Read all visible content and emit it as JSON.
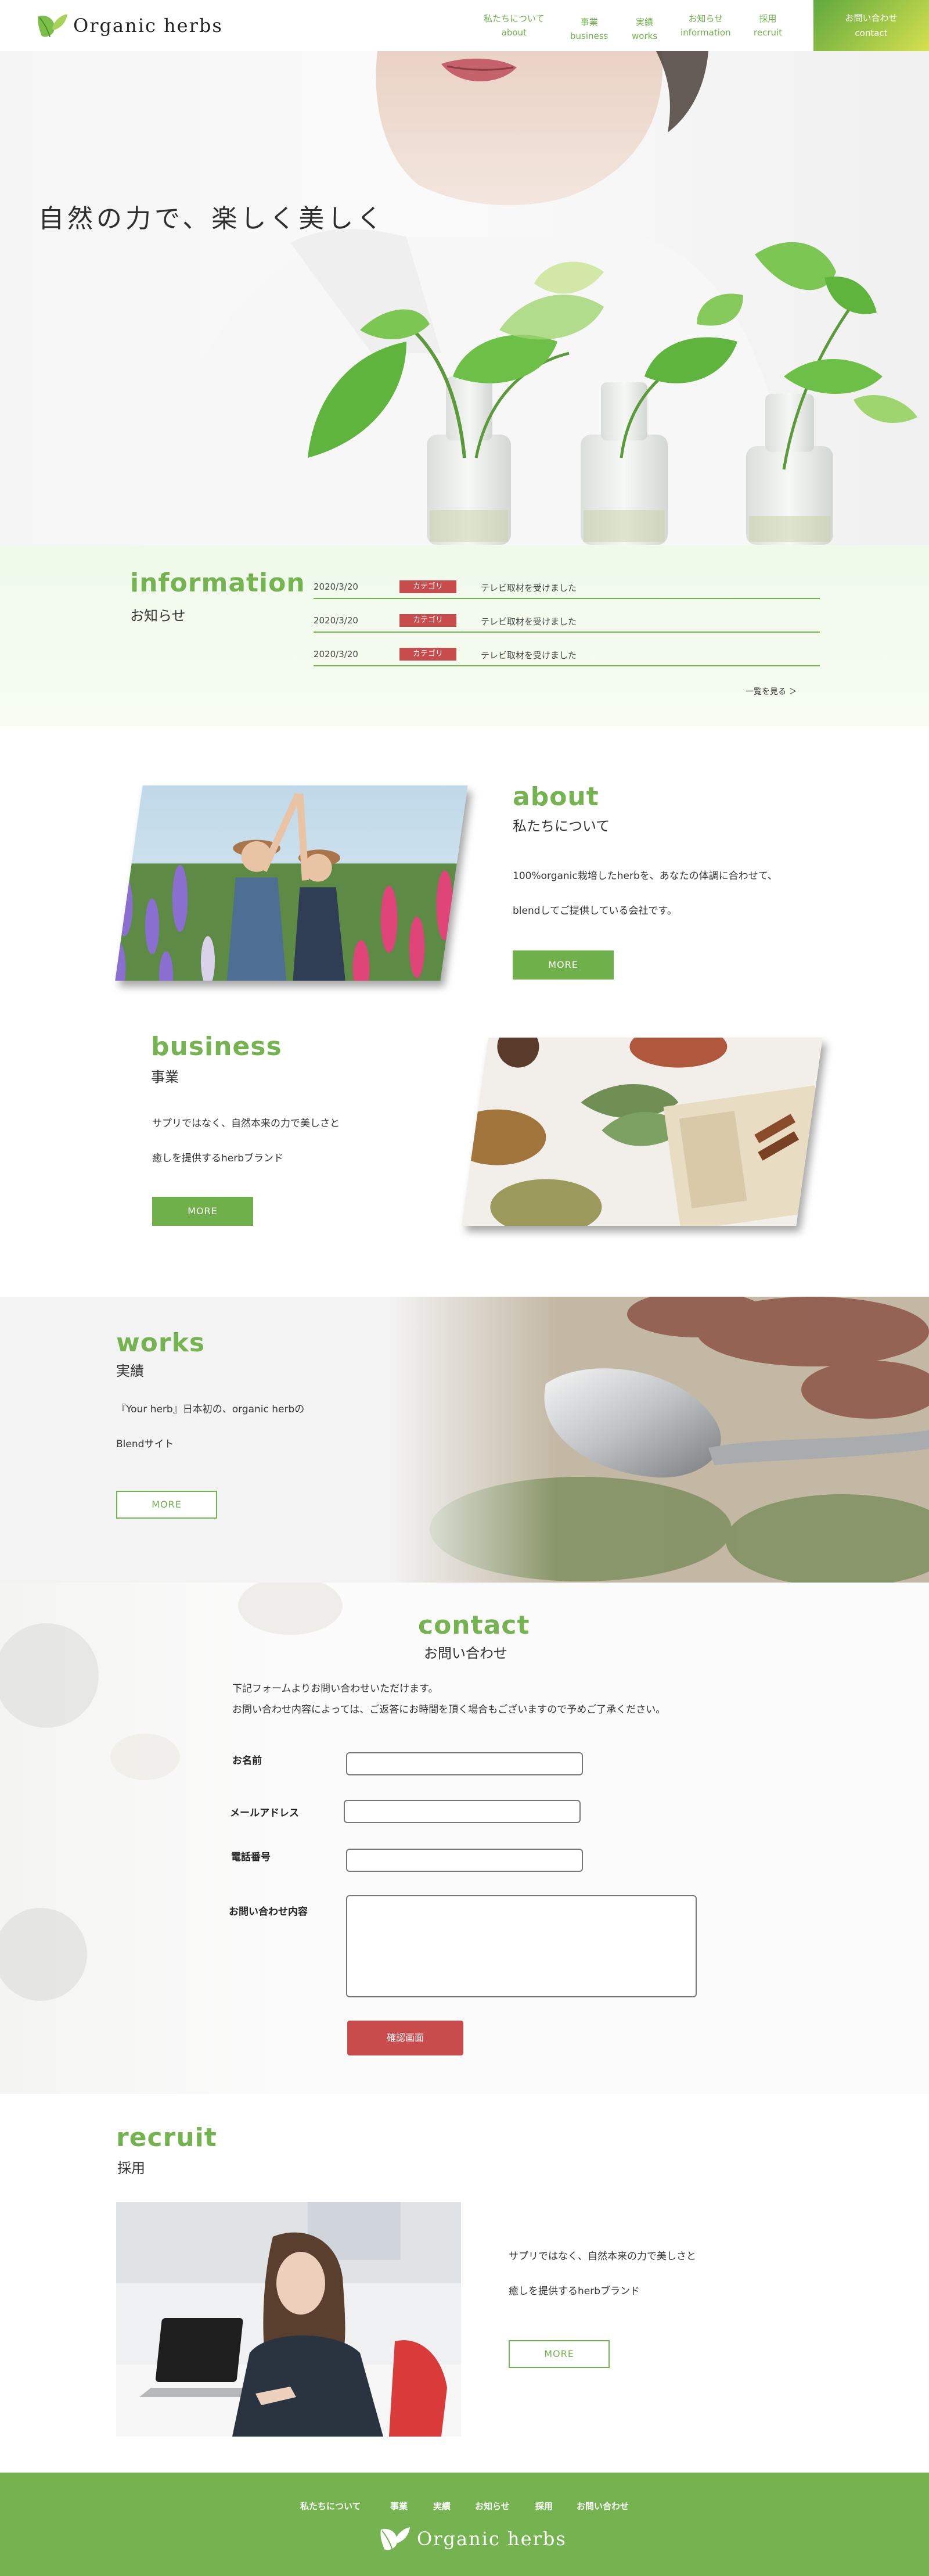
{
  "header": {
    "logo_text": "Organic  herbs",
    "nav": [
      {
        "jp": "私たちについて",
        "en": "about"
      },
      {
        "jp": "事業",
        "en": "business"
      },
      {
        "jp": "実績",
        "en": "works"
      },
      {
        "jp": "お知らせ",
        "en": "information"
      },
      {
        "jp": "採用",
        "en": "recruit"
      }
    ],
    "contact": {
      "jp": "お問い合わせ",
      "en": "contact"
    }
  },
  "hero": {
    "title": "自然の力で、楽しく美しく"
  },
  "information": {
    "title": "information",
    "subtitle": "お知らせ",
    "items": [
      {
        "date": "2020/3/20",
        "category": "カテゴリ",
        "title": "テレビ取材を受けました"
      },
      {
        "date": "2020/3/20",
        "category": "カテゴリ",
        "title": "テレビ取材を受けました"
      },
      {
        "date": "2020/3/20",
        "category": "カテゴリ",
        "title": "テレビ取材を受けました"
      }
    ],
    "view_all": "一覧を見る ＞"
  },
  "about": {
    "title": "about",
    "subtitle": "私たちについて",
    "line1": "100%organic栽培したherbを、あなたの体調に合わせて、",
    "line2": "blendしてご提供している会社です。",
    "more": "MORE"
  },
  "business": {
    "title": "business",
    "subtitle": "事業",
    "line1": "サプリではなく、自然本来の力で美しさと",
    "line2": "癒しを提供するherbブランド",
    "more": "MORE"
  },
  "works": {
    "title": "works",
    "subtitle": "実績",
    "line1": "『Your herb』日本初の、organic herbの",
    "line2": "Blendサイト",
    "more": "MORE"
  },
  "contact": {
    "title": "contact",
    "subtitle": "お問い合わせ",
    "intro1": "下記フォームよりお問い合わせいただけます。",
    "intro2": "お問い合わせ内容によっては、ご返答にお時間を頂く場合もございますので予めご了承ください。",
    "fields": {
      "name": "お名前",
      "email": "メールアドレス",
      "phone": "電話番号",
      "message": "お問い合わせ内容"
    },
    "confirm": "確認画面"
  },
  "recruit": {
    "title": "recruit",
    "subtitle": "採用",
    "line1": "サプリではなく、自然本来の力で美しさと",
    "line2": "癒しを提供するherbブランド",
    "more": "MORE"
  },
  "footer": {
    "links": [
      "私たちについて",
      "事業",
      "実績",
      "お知らせ",
      "採用",
      "お問い合わせ"
    ],
    "logo_text": "Organic  herbs"
  },
  "colors": {
    "accent": "#74b34f",
    "category": "#c94c4c",
    "contact_gradient_end": "#d6e14f"
  }
}
